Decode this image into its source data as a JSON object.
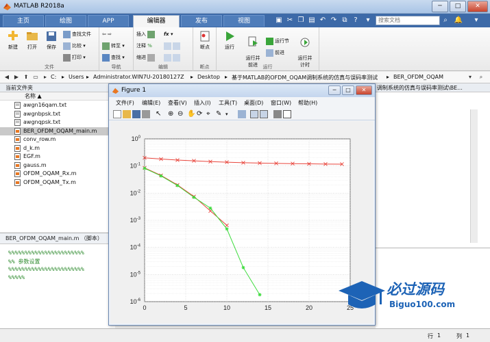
{
  "window": {
    "title": "MATLAB R2018a",
    "minimize": "─",
    "maximize": "□",
    "close": "✕"
  },
  "tabs": [
    "主页",
    "绘图",
    "APP",
    "编辑器",
    "发布",
    "视图"
  ],
  "search": {
    "placeholder": "搜索文档"
  },
  "toolstrip": {
    "file": {
      "label": "文件",
      "new": "新建",
      "open": "打开",
      "save": "保存",
      "find_files": "查找文件",
      "compare": "比较",
      "print": "打印"
    },
    "navigate": {
      "label": "导航",
      "goto": "转至",
      "find": "查找"
    },
    "edit": {
      "label": "编辑",
      "insert": "插入",
      "comment": "注释",
      "indent": "缩进",
      "fx": "fx"
    },
    "breakpoints": {
      "label": "断点",
      "breakpoints": "断点"
    },
    "run": {
      "label": "运行",
      "run": "运行",
      "run_advance": "运行并\n前进",
      "run_section": "运行节",
      "advance": "前进",
      "run_time": "运行并\n计时"
    }
  },
  "address": [
    "C:",
    "Users",
    "Administrator.WIN7U-20180127Z",
    "Desktop",
    "基于MATLAB的OFDM_OQAM调制系统的仿真与误码率测试",
    "BER_OFDM_OQAM"
  ],
  "folder_panel": {
    "title": "当前文件夹",
    "column": "名称 ▲",
    "files": [
      {
        "name": "awgn16qam.txt",
        "selected": false
      },
      {
        "name": "awgnbpsk.txt",
        "selected": false
      },
      {
        "name": "awgnqpsk.txt",
        "selected": false
      },
      {
        "name": "BER_OFDM_OQAM_main.m",
        "selected": true
      },
      {
        "name": "conv_row.m",
        "selected": false
      },
      {
        "name": "d_k.m",
        "selected": false
      },
      {
        "name": "EGF.m",
        "selected": false
      },
      {
        "name": "gauss.m",
        "selected": false
      },
      {
        "name": "OFDM_OQAM_Rx.m",
        "selected": false
      },
      {
        "name": "OFDM_OQAM_Tx.m",
        "selected": false
      }
    ]
  },
  "editor": {
    "title": "BER_OFDM_OQAM_main.m （脚本）",
    "lines": [
      "%%%%%%%%%%%%%%%%%%%%%%%",
      "%%  参数设置",
      "%%%%%%%%%%%%%%%%%%%%%%%",
      "%%%%%"
    ]
  },
  "right_panel": {
    "tab": "调制系统的仿真与误码率测试\\BE..."
  },
  "status": {
    "mode": "行",
    "line_label": "行",
    "line": "1",
    "col_label": "列",
    "col": "1"
  },
  "figure": {
    "title": "Figure 1",
    "menus": [
      "文件(F)",
      "编辑(E)",
      "查看(V)",
      "插入(I)",
      "工具(T)",
      "桌面(D)",
      "窗口(W)",
      "帮助(H)"
    ]
  },
  "chart_data": {
    "type": "line",
    "title": "",
    "xlabel": "",
    "ylabel": "",
    "xlim": [
      0,
      25
    ],
    "ylim": [
      1e-06,
      1
    ],
    "yscale": "log",
    "grid": true,
    "xticks": [
      0,
      5,
      10,
      15,
      20,
      25
    ],
    "yticks": [
      {
        "value": 1e-06,
        "label": "10^-6"
      },
      {
        "value": 1e-05,
        "label": "10^-5"
      },
      {
        "value": 0.0001,
        "label": "10^-4"
      },
      {
        "value": 0.001,
        "label": "10^-3"
      },
      {
        "value": 0.01,
        "label": "10^-2"
      },
      {
        "value": 0.1,
        "label": "10^-1"
      },
      {
        "value": 1,
        "label": "10^0"
      }
    ],
    "series": [
      {
        "color": "#e8453c",
        "marker": "x",
        "x": [
          0,
          2,
          4,
          6,
          8,
          10,
          12,
          14,
          16,
          18,
          20,
          22,
          24
        ],
        "y": [
          0.2,
          0.18,
          0.165,
          0.155,
          0.145,
          0.138,
          0.132,
          0.128,
          0.125,
          0.122,
          0.12,
          0.118,
          0.117
        ]
      },
      {
        "color": "#e8453c",
        "marker": "x",
        "x": [
          0,
          2,
          4,
          6,
          8,
          10
        ],
        "y": [
          0.085,
          0.045,
          0.02,
          0.0075,
          0.0022,
          0.00065
        ]
      },
      {
        "color": "#3cdc3c",
        "marker": "*",
        "x": [
          0,
          2,
          4,
          6,
          8,
          10,
          12,
          14
        ],
        "y": [
          0.082,
          0.043,
          0.019,
          0.007,
          0.0028,
          0.00048,
          1.8e-05,
          1.8e-06
        ]
      }
    ]
  },
  "watermark": {
    "title": "必过源码",
    "subtitle": "Biguo100.com"
  }
}
